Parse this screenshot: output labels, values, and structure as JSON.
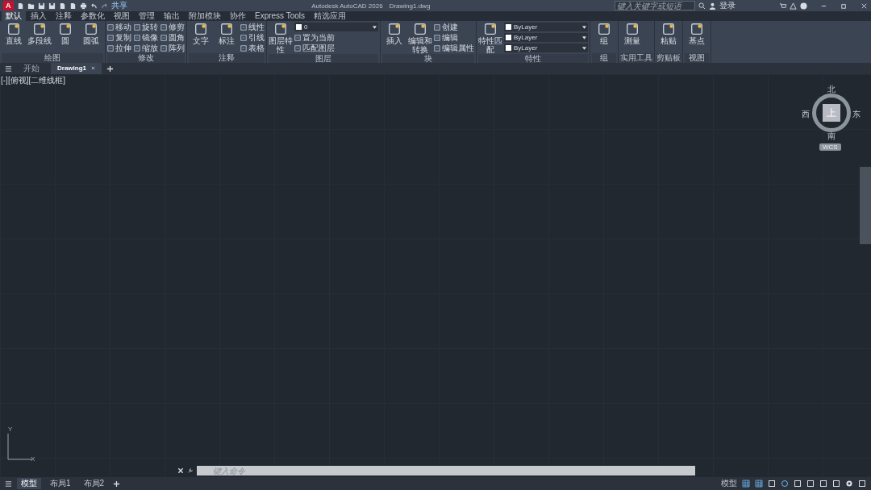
{
  "title_bar": {
    "app_letter": "A",
    "share": "共享",
    "title": "Autodesk AutoCAD 2026",
    "file": "Drawing1.dwg",
    "search": {
      "placeholder": "键入关键字或短语"
    },
    "sign_in": "登录"
  },
  "ribbon_tabs": [
    {
      "label": "默认",
      "selected": true
    },
    {
      "label": "插入",
      "selected": false
    },
    {
      "label": "注释",
      "selected": false
    },
    {
      "label": "参数化",
      "selected": false
    },
    {
      "label": "视图",
      "selected": false
    },
    {
      "label": "管理",
      "selected": false
    },
    {
      "label": "输出",
      "selected": false
    },
    {
      "label": "附加模块",
      "selected": false
    },
    {
      "label": "协作",
      "selected": false
    },
    {
      "label": "Express Tools",
      "selected": false
    },
    {
      "label": "精选应用",
      "selected": false
    }
  ],
  "panels": [
    {
      "title": "绘图",
      "tools": [
        {
          "kind": "large",
          "label": "直线"
        },
        {
          "kind": "large",
          "label": "多段线"
        },
        {
          "kind": "large",
          "label": "圆"
        },
        {
          "kind": "large",
          "label": "圆弧"
        }
      ]
    },
    {
      "title": "修改",
      "tools": [
        {
          "kind": "small",
          "label": "移动"
        },
        {
          "kind": "small",
          "label": "复制"
        },
        {
          "kind": "small",
          "label": "拉伸"
        },
        {
          "kind": "small",
          "label": "旋转"
        },
        {
          "kind": "small",
          "label": "镜像"
        },
        {
          "kind": "small",
          "label": "缩放"
        },
        {
          "kind": "small",
          "label": "修剪"
        },
        {
          "kind": "small",
          "label": "圆角"
        },
        {
          "kind": "small",
          "label": "阵列"
        }
      ]
    },
    {
      "title": "注释",
      "tools": [
        {
          "kind": "large",
          "label": "文字"
        },
        {
          "kind": "large",
          "label": "标注"
        },
        {
          "kind": "small",
          "label": "线性"
        },
        {
          "kind": "small",
          "label": "引线"
        },
        {
          "kind": "small",
          "label": "表格"
        }
      ]
    },
    {
      "title": "图层",
      "tools": [
        {
          "kind": "large",
          "label": "图层特性"
        },
        {
          "kind": "dropdown",
          "value": "0"
        },
        {
          "kind": "small",
          "label": "置为当前"
        },
        {
          "kind": "small",
          "label": "匹配图层"
        }
      ]
    },
    {
      "title": "块",
      "tools": [
        {
          "kind": "large",
          "label": "插入"
        },
        {
          "kind": "large",
          "label": "编辑和转换"
        },
        {
          "kind": "small",
          "label": "创建"
        },
        {
          "kind": "small",
          "label": "编辑"
        },
        {
          "kind": "small",
          "label": "编辑属性"
        }
      ]
    },
    {
      "title": "特性",
      "tools": [
        {
          "kind": "large",
          "label": "特性匹配"
        },
        {
          "kind": "dropdown",
          "value": "ByLayer"
        },
        {
          "kind": "dropdown",
          "value": "ByLayer"
        },
        {
          "kind": "dropdown",
          "value": "ByLayer"
        }
      ]
    },
    {
      "title": "组",
      "tools": [
        {
          "kind": "large",
          "label": "组"
        }
      ]
    },
    {
      "title": "实用工具",
      "tools": [
        {
          "kind": "large",
          "label": "测量"
        }
      ]
    },
    {
      "title": "剪贴板",
      "tools": [
        {
          "kind": "large",
          "label": "粘贴"
        }
      ]
    },
    {
      "title": "视图",
      "tools": [
        {
          "kind": "large",
          "label": "基点"
        }
      ]
    }
  ],
  "file_tabs": [
    {
      "label": "开始",
      "selected": false
    },
    {
      "label": "Drawing1",
      "selected": true
    }
  ],
  "viewport": {
    "label": "[-][俯视][二维线框]"
  },
  "viewcube": {
    "north": "北",
    "south": "南",
    "east": "东",
    "west": "西",
    "top": "上",
    "wcs": "WCS"
  },
  "ucs": {
    "x": "X",
    "y": "Y"
  },
  "command_line": {
    "placeholder": "键入命令"
  },
  "layout_tabs": [
    {
      "label": "模型",
      "selected": true
    },
    {
      "label": "布局1",
      "selected": false
    },
    {
      "label": "布局2",
      "selected": false
    }
  ],
  "status_bar": {
    "space": "模型"
  }
}
